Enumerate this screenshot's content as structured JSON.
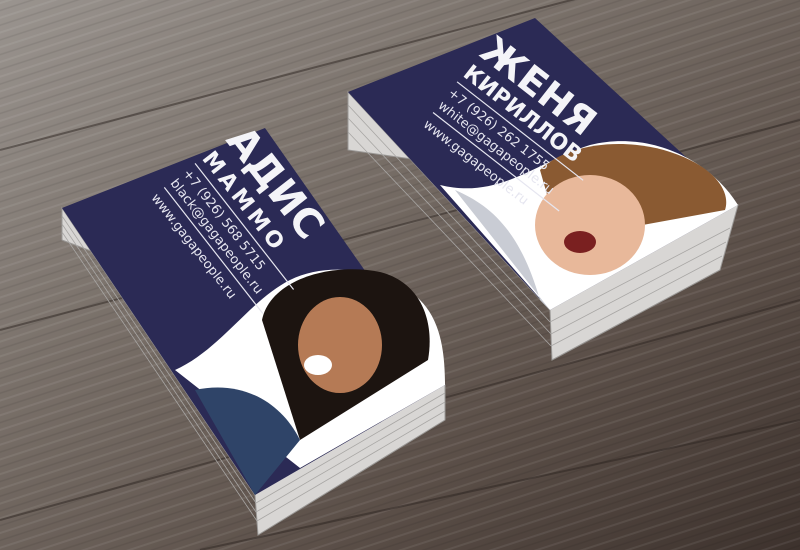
{
  "cards": [
    {
      "first_name": "АДИС",
      "last_name": "МАММО",
      "phone": "+7 (926) 568 5715",
      "email": "black@gagapeople.ru",
      "website": "www.gagapeople.ru"
    },
    {
      "first_name": "ЖЕНЯ",
      "last_name": "КИРИЛЛОВ",
      "phone": "+7 (926) 262 1755",
      "email": "white@gagapeople.ru",
      "website": "www.gagapeople.ru"
    }
  ],
  "colors": {
    "card": "#2b2a55",
    "wood": "#6b625c"
  }
}
